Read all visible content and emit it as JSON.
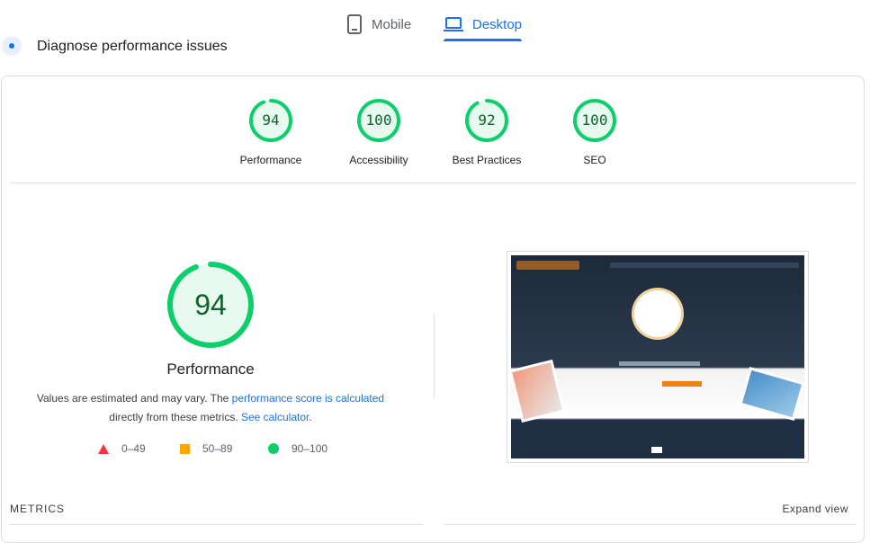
{
  "tabs": [
    {
      "label": "Mobile",
      "icon": "phone-icon",
      "active": false
    },
    {
      "label": "Desktop",
      "icon": "laptop-icon",
      "active": true
    }
  ],
  "heading": {
    "title": "Diagnose performance issues"
  },
  "scores": [
    {
      "value": "94",
      "label": "Performance",
      "fraction": 0.94
    },
    {
      "value": "100",
      "label": "Accessibility",
      "fraction": 1.0
    },
    {
      "value": "92",
      "label": "Best Practices",
      "fraction": 0.92
    },
    {
      "value": "100",
      "label": "SEO",
      "fraction": 1.0
    }
  ],
  "main_score": {
    "value": "94",
    "label": "Performance",
    "fraction": 0.94
  },
  "note": {
    "text1": "Values are estimated and may vary. The ",
    "link1": "performance score is calculated",
    "text2": "directly from these metrics. ",
    "link2": "See calculator",
    "text3": "."
  },
  "legend": [
    {
      "label": "0–49",
      "shape": "triangle",
      "color": "#ff3333"
    },
    {
      "label": "50–89",
      "shape": "square",
      "color": "#ffa400"
    },
    {
      "label": "90–100",
      "shape": "circle",
      "color": "#0cce6b"
    }
  ],
  "metrics": {
    "label": "METRICS",
    "expand": "Expand view"
  },
  "colors": {
    "pass": "#0cce6b",
    "pass_text": "#0d652d",
    "pass_bg": "#e8f9ef",
    "accent": "#1a73e8"
  }
}
